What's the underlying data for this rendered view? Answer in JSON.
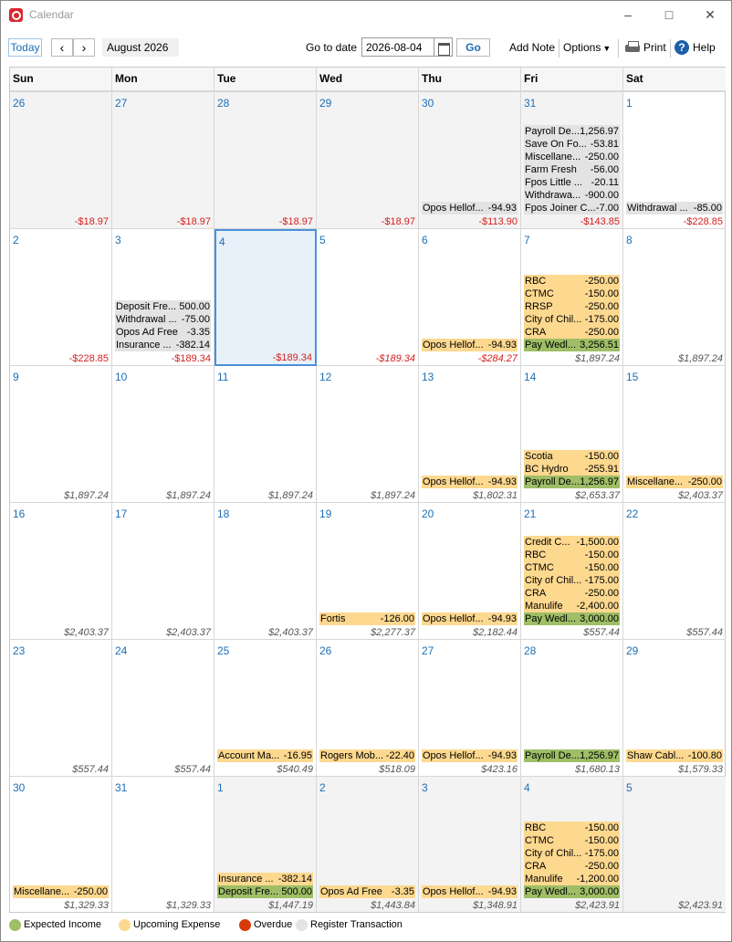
{
  "window": {
    "title": "Calendar"
  },
  "toolbar": {
    "today": "Today",
    "month_label": "August 2026",
    "goto_label": "Go to date",
    "date_value": "2026-08-04",
    "go": "Go",
    "add_note": "Add Note",
    "options": "Options",
    "print": "Print",
    "help": "Help"
  },
  "weekdays": [
    "Sun",
    "Mon",
    "Tue",
    "Wed",
    "Thu",
    "Fri",
    "Sat"
  ],
  "weeks": [
    [
      {
        "day": "26",
        "gray": true,
        "balance": "-$18.97",
        "bal_style": "red",
        "tx": []
      },
      {
        "day": "27",
        "gray": true,
        "balance": "-$18.97",
        "bal_style": "red",
        "tx": []
      },
      {
        "day": "28",
        "gray": true,
        "balance": "-$18.97",
        "bal_style": "red",
        "tx": []
      },
      {
        "day": "29",
        "gray": true,
        "balance": "-$18.97",
        "bal_style": "red",
        "tx": []
      },
      {
        "day": "30",
        "gray": true,
        "balance": "-$113.90",
        "bal_style": "red",
        "tx": [
          {
            "n": "Opos Hellof...",
            "a": "-94.93",
            "c": "g"
          }
        ]
      },
      {
        "day": "31",
        "gray": true,
        "balance": "-$143.85",
        "bal_style": "red",
        "tx": [
          {
            "n": "Payroll De...",
            "a": "1,256.97",
            "c": "g"
          },
          {
            "n": "Save On Fo...",
            "a": "-53.81",
            "c": "g"
          },
          {
            "n": "Miscellane...",
            "a": "-250.00",
            "c": "g"
          },
          {
            "n": "Farm Fresh",
            "a": "-56.00",
            "c": "g"
          },
          {
            "n": "Fpos Little ...",
            "a": "-20.11",
            "c": "g"
          },
          {
            "n": "Withdrawa...",
            "a": "-900.00",
            "c": "g"
          },
          {
            "n": "Fpos Joiner C...",
            "a": "-7.00",
            "c": "g"
          }
        ]
      },
      {
        "day": "1",
        "gray": false,
        "balance": "-$228.85",
        "bal_style": "red",
        "tx": [
          {
            "n": "Withdrawal ...",
            "a": "-85.00",
            "c": "g"
          }
        ]
      }
    ],
    [
      {
        "day": "2",
        "gray": false,
        "balance": "-$228.85",
        "bal_style": "red",
        "tx": []
      },
      {
        "day": "3",
        "gray": false,
        "balance": "-$189.34",
        "bal_style": "red",
        "tx": [
          {
            "n": "Deposit Fre...",
            "a": "500.00",
            "c": "g"
          },
          {
            "n": "Withdrawal ...",
            "a": "-75.00",
            "c": "g"
          },
          {
            "n": "Opos Ad Free",
            "a": "-3.35",
            "c": "g"
          },
          {
            "n": "Insurance ...",
            "a": "-382.14",
            "c": "g"
          }
        ]
      },
      {
        "day": "4",
        "gray": false,
        "selected": true,
        "balance": "-$189.34",
        "bal_style": "red",
        "tx": []
      },
      {
        "day": "5",
        "gray": false,
        "balance": "-$189.34",
        "bal_style": "ri",
        "tx": []
      },
      {
        "day": "6",
        "gray": false,
        "balance": "-$284.27",
        "bal_style": "ri",
        "tx": [
          {
            "n": "Opos Hellof...",
            "a": "-94.93",
            "c": "y"
          }
        ]
      },
      {
        "day": "7",
        "gray": false,
        "balance": "$1,897.24",
        "bal_style": "gi",
        "tx": [
          {
            "n": "RBC",
            "a": "-250.00",
            "c": "y"
          },
          {
            "n": "CTMC",
            "a": "-150.00",
            "c": "y"
          },
          {
            "n": "RRSP",
            "a": "-250.00",
            "c": "y"
          },
          {
            "n": "City of Chil...",
            "a": "-175.00",
            "c": "y"
          },
          {
            "n": "CRA",
            "a": "-250.00",
            "c": "y"
          },
          {
            "n": "Pay Wedl...",
            "a": "3,256.51",
            "c": "i"
          }
        ]
      },
      {
        "day": "8",
        "gray": false,
        "balance": "$1,897.24",
        "bal_style": "gi",
        "tx": []
      }
    ],
    [
      {
        "day": "9",
        "gray": false,
        "balance": "$1,897.24",
        "bal_style": "gi",
        "tx": []
      },
      {
        "day": "10",
        "gray": false,
        "balance": "$1,897.24",
        "bal_style": "gi",
        "tx": []
      },
      {
        "day": "11",
        "gray": false,
        "balance": "$1,897.24",
        "bal_style": "gi",
        "tx": []
      },
      {
        "day": "12",
        "gray": false,
        "balance": "$1,897.24",
        "bal_style": "gi",
        "tx": []
      },
      {
        "day": "13",
        "gray": false,
        "balance": "$1,802.31",
        "bal_style": "gi",
        "tx": [
          {
            "n": "Opos Hellof...",
            "a": "-94.93",
            "c": "y"
          }
        ]
      },
      {
        "day": "14",
        "gray": false,
        "balance": "$2,653.37",
        "bal_style": "gi",
        "tx": [
          {
            "n": "Scotia",
            "a": "-150.00",
            "c": "y"
          },
          {
            "n": "BC Hydro",
            "a": "-255.91",
            "c": "y"
          },
          {
            "n": "Payroll De...",
            "a": "1,256.97",
            "c": "i"
          }
        ]
      },
      {
        "day": "15",
        "gray": false,
        "balance": "$2,403.37",
        "bal_style": "gi",
        "tx": [
          {
            "n": "Miscellane...",
            "a": "-250.00",
            "c": "y"
          }
        ]
      }
    ],
    [
      {
        "day": "16",
        "gray": false,
        "balance": "$2,403.37",
        "bal_style": "gi",
        "tx": []
      },
      {
        "day": "17",
        "gray": false,
        "balance": "$2,403.37",
        "bal_style": "gi",
        "tx": []
      },
      {
        "day": "18",
        "gray": false,
        "balance": "$2,403.37",
        "bal_style": "gi",
        "tx": []
      },
      {
        "day": "19",
        "gray": false,
        "balance": "$2,277.37",
        "bal_style": "gi",
        "tx": [
          {
            "n": "Fortis",
            "a": "-126.00",
            "c": "y"
          }
        ]
      },
      {
        "day": "20",
        "gray": false,
        "balance": "$2,182.44",
        "bal_style": "gi",
        "tx": [
          {
            "n": "Opos Hellof...",
            "a": "-94.93",
            "c": "y"
          }
        ]
      },
      {
        "day": "21",
        "gray": false,
        "balance": "$557.44",
        "bal_style": "gi",
        "tx": [
          {
            "n": "Credit C...",
            "a": "-1,500.00",
            "c": "y"
          },
          {
            "n": "RBC",
            "a": "-150.00",
            "c": "y"
          },
          {
            "n": "CTMC",
            "a": "-150.00",
            "c": "y"
          },
          {
            "n": "City of Chil...",
            "a": "-175.00",
            "c": "y"
          },
          {
            "n": "CRA",
            "a": "-250.00",
            "c": "y"
          },
          {
            "n": "Manulife",
            "a": "-2,400.00",
            "c": "y"
          },
          {
            "n": "Pay Wedl...",
            "a": "3,000.00",
            "c": "i"
          }
        ]
      },
      {
        "day": "22",
        "gray": false,
        "balance": "$557.44",
        "bal_style": "gi",
        "tx": []
      }
    ],
    [
      {
        "day": "23",
        "gray": false,
        "balance": "$557.44",
        "bal_style": "gi",
        "tx": []
      },
      {
        "day": "24",
        "gray": false,
        "balance": "$557.44",
        "bal_style": "gi",
        "tx": []
      },
      {
        "day": "25",
        "gray": false,
        "balance": "$540.49",
        "bal_style": "gi",
        "tx": [
          {
            "n": "Account Ma...",
            "a": "-16.95",
            "c": "y"
          }
        ]
      },
      {
        "day": "26",
        "gray": false,
        "balance": "$518.09",
        "bal_style": "gi",
        "tx": [
          {
            "n": "Rogers Mob...",
            "a": "-22.40",
            "c": "y"
          }
        ]
      },
      {
        "day": "27",
        "gray": false,
        "balance": "$423.16",
        "bal_style": "gi",
        "tx": [
          {
            "n": "Opos Hellof...",
            "a": "-94.93",
            "c": "y"
          }
        ]
      },
      {
        "day": "28",
        "gray": false,
        "balance": "$1,680.13",
        "bal_style": "gi",
        "tx": [
          {
            "n": "Payroll De...",
            "a": "1,256.97",
            "c": "i"
          }
        ]
      },
      {
        "day": "29",
        "gray": false,
        "balance": "$1,579.33",
        "bal_style": "gi",
        "tx": [
          {
            "n": "Shaw Cabl...",
            "a": "-100.80",
            "c": "y"
          }
        ]
      }
    ],
    [
      {
        "day": "30",
        "gray": false,
        "balance": "$1,329.33",
        "bal_style": "gi",
        "tx": [
          {
            "n": "Miscellane...",
            "a": "-250.00",
            "c": "y"
          }
        ]
      },
      {
        "day": "31",
        "gray": false,
        "balance": "$1,329.33",
        "bal_style": "gi",
        "tx": []
      },
      {
        "day": "1",
        "gray": true,
        "balance": "$1,447.19",
        "bal_style": "gi",
        "tx": [
          {
            "n": "Insurance ...",
            "a": "-382.14",
            "c": "y"
          },
          {
            "n": "Deposit Fre...",
            "a": "500.00",
            "c": "i"
          }
        ]
      },
      {
        "day": "2",
        "gray": true,
        "balance": "$1,443.84",
        "bal_style": "gi",
        "tx": [
          {
            "n": "Opos Ad Free",
            "a": "-3.35",
            "c": "y"
          }
        ]
      },
      {
        "day": "3",
        "gray": true,
        "balance": "$1,348.91",
        "bal_style": "gi",
        "tx": [
          {
            "n": "Opos Hellof...",
            "a": "-94.93",
            "c": "y"
          }
        ]
      },
      {
        "day": "4",
        "gray": true,
        "balance": "$2,423.91",
        "bal_style": "gi",
        "tx": [
          {
            "n": "RBC",
            "a": "-150.00",
            "c": "y"
          },
          {
            "n": "CTMC",
            "a": "-150.00",
            "c": "y"
          },
          {
            "n": "City of Chil...",
            "a": "-175.00",
            "c": "y"
          },
          {
            "n": "CRA",
            "a": "-250.00",
            "c": "y"
          },
          {
            "n": "Manulife",
            "a": "-1,200.00",
            "c": "y"
          },
          {
            "n": "Pay Wedl...",
            "a": "3,000.00",
            "c": "i"
          }
        ]
      },
      {
        "day": "5",
        "gray": true,
        "balance": "$2,423.91",
        "bal_style": "gi",
        "tx": []
      }
    ]
  ],
  "legend": [
    {
      "label": "Expected Income",
      "color": "#9fbe66"
    },
    {
      "label": "Upcoming Expense",
      "color": "#fdd88f"
    },
    {
      "label": "Overdue",
      "color": "#d83b0b"
    },
    {
      "label": "Register Transaction",
      "color": "#e3e3e3"
    }
  ]
}
